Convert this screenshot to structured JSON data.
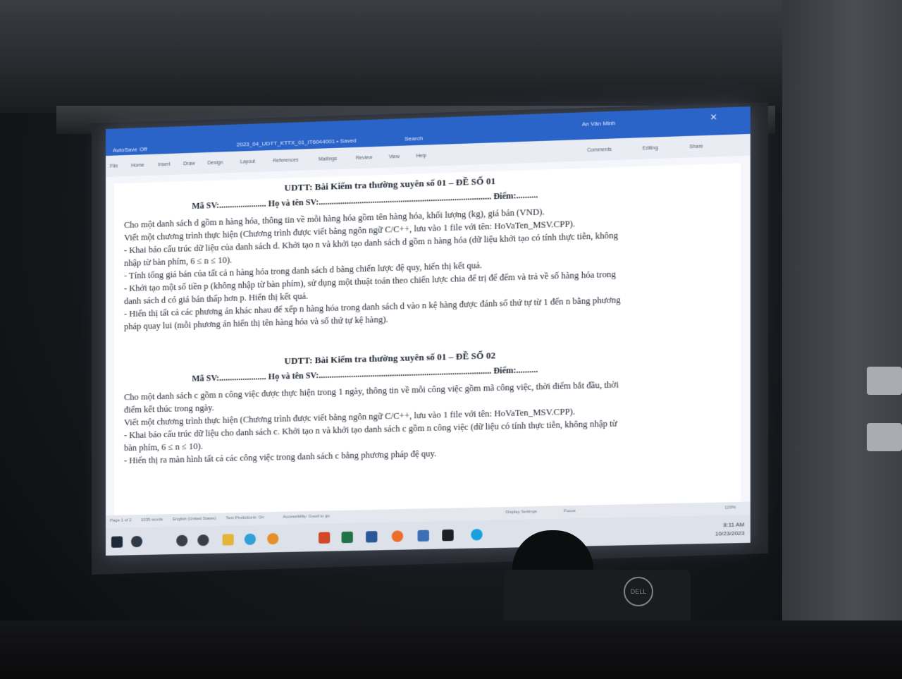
{
  "word": {
    "title": "2023_04_UDTT_KTTX_01_IT6044001 • Saved",
    "autosave": "AutoSave",
    "autosave_state": "Off",
    "search": "Search",
    "user": "An Văn Minh",
    "comments": "Comments",
    "editing": "Editing",
    "share": "Share",
    "tabs": [
      "File",
      "Home",
      "Insert",
      "Draw",
      "Design",
      "Layout",
      "References",
      "Mailings",
      "Review",
      "View",
      "Help"
    ]
  },
  "document": {
    "lines": [
      "UDTT: Bài Kiểm tra thường xuyên số 01 – ĐỀ SỐ 01",
      "Mã SV:...................... Họ và tên SV:................................................................................ Điểm:..........",
      "Cho một danh sách d gồm n hàng hóa, thông tin về mỗi hàng hóa gồm tên hàng hóa, khối lượng (kg), giá bán (VND).",
      "Viết một chương trình thực hiện (Chương trình được viết bằng ngôn ngữ C/C++, lưu vào 1 file với tên: HoVaTen_MSV.CPP).",
      "- Khai báo cấu trúc dữ liệu của danh sách d. Khởi tạo n và khởi tạo danh sách d gồm n hàng hóa (dữ liệu khởi tạo có tính thực tiễn, không",
      "nhập từ bàn phím, 6 ≤ n ≤ 10).",
      "- Tính tổng giá bán của tất cả n hàng hóa trong danh sách d bằng chiến lược đệ quy, hiển thị kết quả.",
      "- Khởi tạo một số tiền p (không nhập từ bàn phím), sử dụng một thuật toán theo chiến lược chia để trị để đếm và trả về số hàng hóa trong",
      "danh sách d có giá bán thấp hơn p. Hiển thị kết quả.",
      "- Hiển thị tất cả các phương án khác nhau để xếp n hàng hóa trong danh sách d vào n kệ hàng được đánh số thứ tự từ 1 đến n bằng phương",
      "pháp quay lui (mỗi phương án hiển thị tên hàng hóa và số thứ tự kệ hàng).",
      "UDTT: Bài Kiểm tra thường xuyên số 01 – ĐỀ SỐ 02",
      "Mã SV:...................... Họ và tên SV:................................................................................ Điểm:..........",
      "Cho một danh sách c gồm n công việc được thực hiện trong 1 ngày, thông tin về mỗi công việc gồm mã công việc, thời điểm bắt đầu, thời",
      "điểm kết thúc trong ngày.",
      "Viết một chương trình thực hiện (Chương trình được viết bằng ngôn ngữ C/C++, lưu vào 1 file với tên: HoVaTen_MSV.CPP).",
      "- Khai báo cấu trúc dữ liệu cho danh sách c. Khởi tạo n và khởi tạo danh sách c gồm n công việc (dữ liệu có tính thực tiễn, không nhập từ",
      "bàn phím, 6 ≤ n ≤ 10).",
      "- Hiển thị ra màn hình tất cả các công việc trong danh sách c bằng phương pháp đệ quy."
    ]
  },
  "status": {
    "page": "Page 1 of 2",
    "words": "1035 words",
    "language": "English (United States)",
    "predictions": "Text Predictions: On",
    "accessibility": "Accessibility: Good to go",
    "display": "Display Settings",
    "focus": "Focus",
    "zoom": "120%"
  },
  "taskbar": {
    "time": "8:11 AM",
    "date": "10/23/2023"
  },
  "brand": "DELL"
}
